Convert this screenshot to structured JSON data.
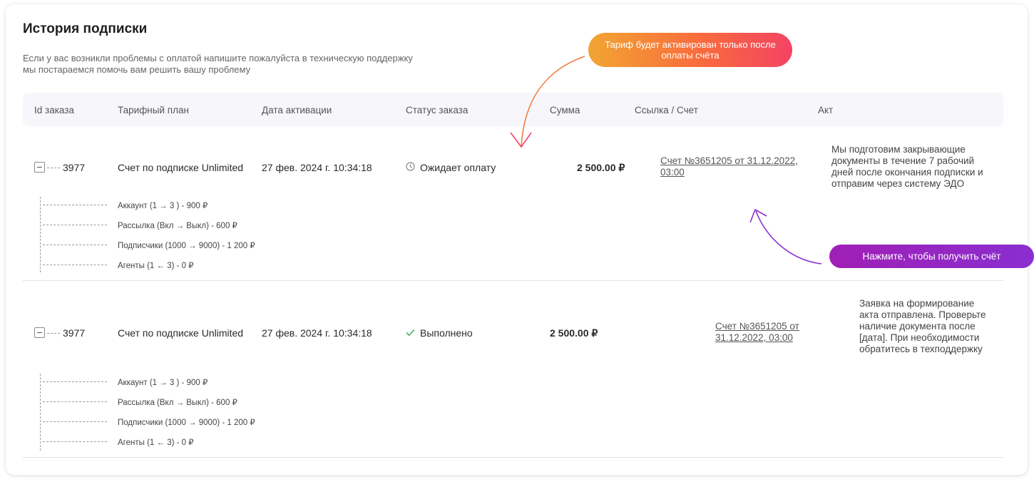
{
  "page": {
    "title": "История подписки",
    "description": "Если у вас возникли проблемы с оплатой напишите пожалуйста в техническую поддержку мы постараемся помочь вам решить вашу проблему"
  },
  "table": {
    "columns": [
      "Id заказа",
      "Тарифный план",
      "Дата активации",
      "Статус заказа",
      "Сумма",
      "Ссылка / Счет",
      "Акт"
    ],
    "rows": [
      {
        "id": "3977",
        "plan": "Счет по подписке Unlimited",
        "date": "27 фев. 2024 г. 10:34:18",
        "status": "Ожидает оплату",
        "status_icon": "clock-icon",
        "sum": "2 500.00 ₽",
        "invoice": "Счет №3651205 от 31.12.2022, 03:00",
        "act": "Мы подготовим закрывающие документы в течение 7 рабочий дней после окончания подписки и отправим через систему ЭДО",
        "items": [
          "Аккаунт (1 → 3 )  - 900 ₽",
          "Рассылка (Вкл → Выкл)  - 600 ₽",
          "Подписчики (1000 → 9000)  - 1 200 ₽",
          "Агенты (1 ← 3)  - 0 ₽"
        ]
      },
      {
        "id": "3977",
        "plan": "Счет по подписке Unlimited",
        "date": "27 фев. 2024 г. 10:34:18",
        "status": "Выполнено",
        "status_icon": "check-icon",
        "sum": "2 500.00 ₽",
        "invoice": "Счет №3651205 от 31.12.2022, 03:00",
        "act": "Заявка на формирование акта отправлена. Проверьте наличие документа после [дата]. При необходимости обратитесь в техподдержку",
        "items": [
          "Аккаунт (1 → 3 )  - 900 ₽",
          "Рассылка (Вкл → Выкл)  - 600 ₽",
          "Подписчики (1000 → 9000)  - 1 200 ₽",
          "Агенты (1 ← 3)  - 0 ₽"
        ]
      }
    ]
  },
  "annotations": {
    "tariff_note": "Тариф будет активирован только после оплаты счёта",
    "invoice_hint": "Нажмите, чтобы получить счёт"
  },
  "colors": {
    "check": "#3aaa5a",
    "badge_orange": "#f2a533",
    "badge_pink": "#f44363",
    "badge_purple": "#8a2ed0"
  }
}
